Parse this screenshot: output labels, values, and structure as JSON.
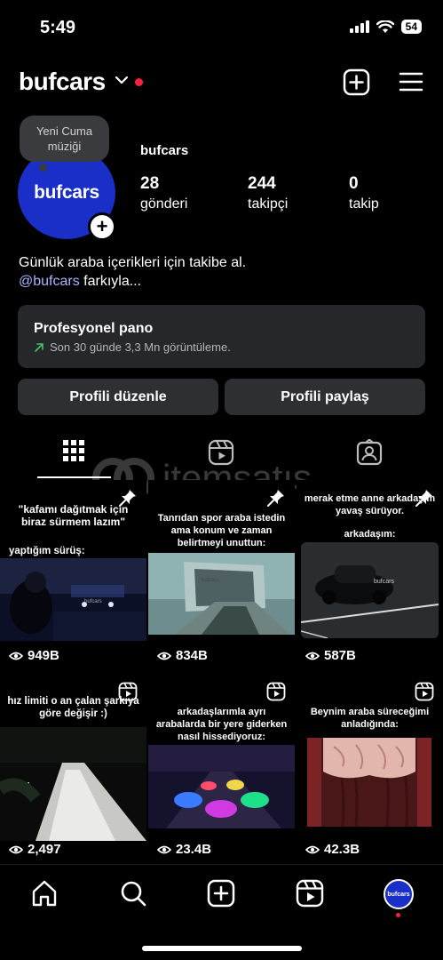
{
  "status_bar": {
    "time": "5:49",
    "battery": "54"
  },
  "header": {
    "username": "bufcars"
  },
  "note": {
    "text": "Yeni Cuma müziği"
  },
  "avatar": {
    "text": "bufcars"
  },
  "profile": {
    "name": "bufcars",
    "stats": [
      {
        "value": "28",
        "label": "gönderi"
      },
      {
        "value": "244",
        "label": "takipçi"
      },
      {
        "value": "0",
        "label": "takip"
      }
    ],
    "bio_line1": "Günlük araba içerikleri için takibe al.",
    "bio_mention": "@bufcars",
    "bio_rest": " farkıyla..."
  },
  "pro_panel": {
    "title": "Profesyonel pano",
    "subtitle": "Son 30 günde 3,3 Mn görüntüleme."
  },
  "buttons": {
    "edit": "Profili düzenle",
    "share": "Profili paylaş"
  },
  "watermark": {
    "text": "itemsatış"
  },
  "posts": [
    {
      "caption_a": "\"kafamı dağıtmak için biraz sürmem lazım\"",
      "caption_b": "yaptığım sürüş:",
      "views": "949B",
      "badge": "pin-icon"
    },
    {
      "caption_a": "Tanrıdan spor araba istedin ama konum ve zaman belirtmeyi unuttun:",
      "caption_b": "",
      "views": "834B",
      "badge": "pin-icon"
    },
    {
      "caption_a": "merak etme anne arkadaşım yavaş sürüyor.",
      "caption_b": "arkadaşım:",
      "views": "587B",
      "badge": "pin-icon"
    },
    {
      "caption_a": "hız limiti o an çalan şarkıya göre değişir :)",
      "caption_b": "",
      "views": "2,497",
      "badge": "reels-icon"
    },
    {
      "caption_a": "arkadaşlarımla ayrı arabalarda bir yere giderken nasıl hissediyoruz:",
      "caption_b": "",
      "views": "23.4B",
      "badge": "reels-icon"
    },
    {
      "caption_a": "Beynim araba süreceğimi anladığında:",
      "caption_b": "",
      "views": "42.3B",
      "badge": "reels-icon"
    }
  ],
  "image_marks": {
    "p1": "bufcars",
    "p2": "bufcars"
  },
  "nav": {
    "profile_avatar_text": "bufcars"
  }
}
